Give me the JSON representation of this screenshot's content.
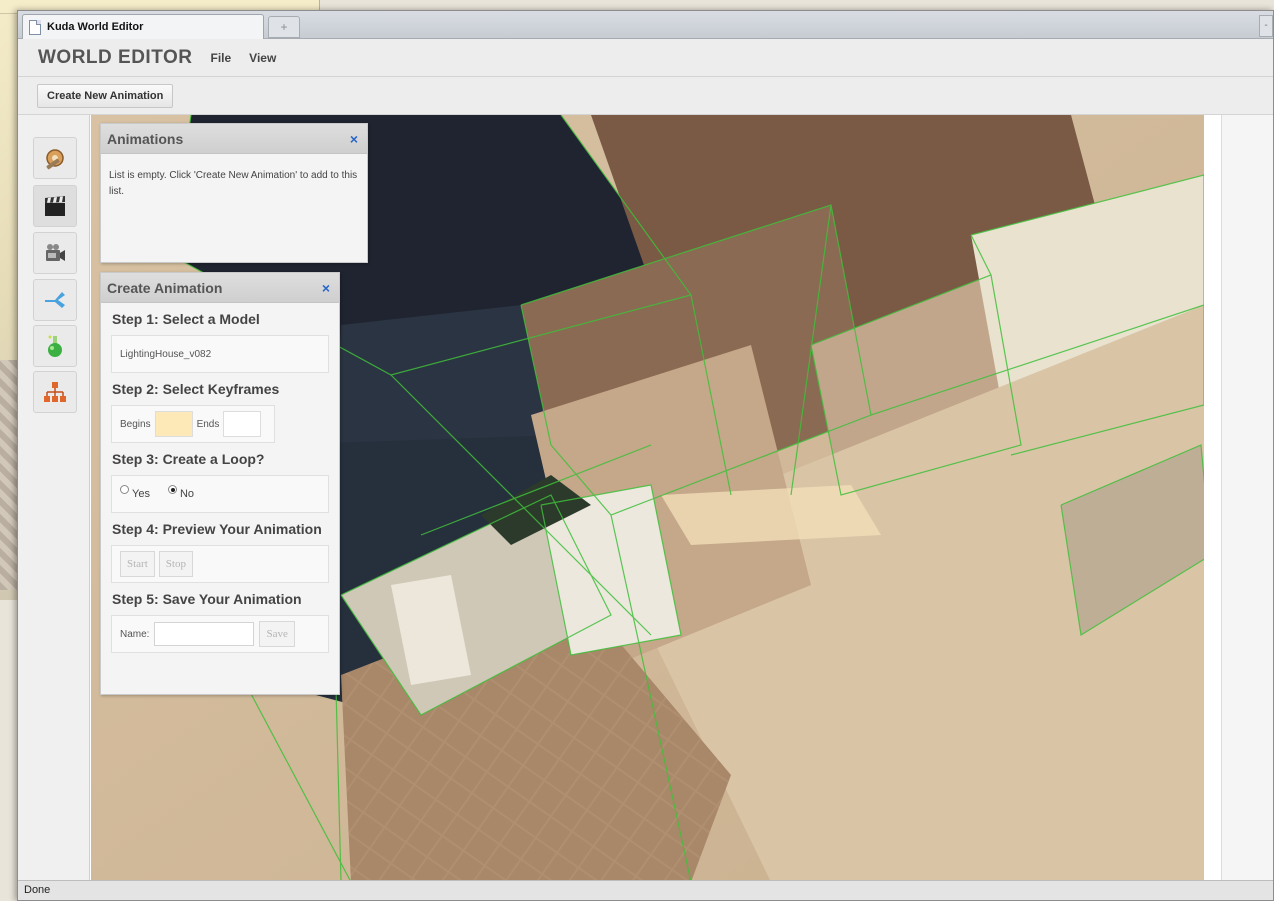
{
  "browser": {
    "tab_title": "Kuda World Editor",
    "new_tab_glyph": "+",
    "right_glyph": "-"
  },
  "header": {
    "app_title": "WORLD EDITOR",
    "menu": [
      {
        "label": "File"
      },
      {
        "label": "View"
      }
    ]
  },
  "toolbar": {
    "create_new_animation_label": "Create New Animation"
  },
  "sidebar": {
    "items": [
      {
        "icon": "tools-icon"
      },
      {
        "icon": "clapperboard-icon"
      },
      {
        "icon": "camera-icon"
      },
      {
        "icon": "share-icon"
      },
      {
        "icon": "potion-icon"
      },
      {
        "icon": "hierarchy-icon"
      }
    ]
  },
  "animations_panel": {
    "title": "Animations",
    "close_glyph": "×",
    "empty_text": "List is empty. Click 'Create New Animation' to add to this list."
  },
  "create_animation_panel": {
    "title": "Create Animation",
    "close_glyph": "×",
    "step1": {
      "title": "Step 1: Select a Model",
      "model_value": "LightingHouse_v082"
    },
    "step2": {
      "title": "Step 2: Select Keyframes",
      "begins_label": "Begins",
      "ends_label": "Ends"
    },
    "step3": {
      "title": "Step 3: Create a Loop?",
      "yes_label": "Yes",
      "no_label": "No",
      "selected": "No"
    },
    "step4": {
      "title": "Step 4: Preview Your Animation",
      "start_label": "Start",
      "stop_label": "Stop"
    },
    "step5": {
      "title": "Step 5: Save Your Animation",
      "name_label": "Name:",
      "save_label": "Save"
    }
  },
  "status": {
    "text": "Done"
  },
  "colors": {
    "accent_blue": "#2a66c8",
    "wireframe_green": "#3fbf3a",
    "keyframe_begins": "#fde9b7"
  }
}
